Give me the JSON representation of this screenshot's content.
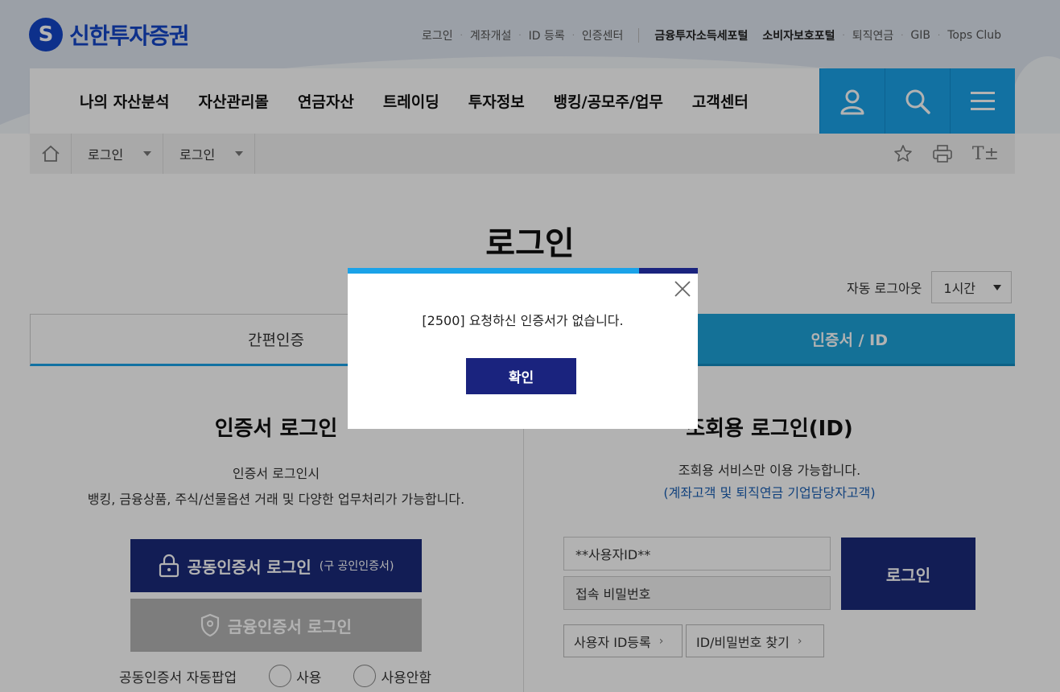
{
  "brand": {
    "logo_text": "신한투자증권",
    "logo_mark": "S"
  },
  "util_nav": [
    {
      "label": "로그인"
    },
    {
      "label": "계좌개설"
    },
    {
      "label": "ID 등록"
    },
    {
      "label": "인증센터"
    }
  ],
  "util_nav_bold": [
    {
      "label": "금융투자소득세포털"
    },
    {
      "label": "소비자보호포털"
    }
  ],
  "util_nav_extra": [
    {
      "label": "퇴직연금"
    },
    {
      "label": "GIB"
    },
    {
      "label": "Tops Club"
    }
  ],
  "gnb": {
    "menus": [
      "나의 자산분석",
      "자산관리몰",
      "연금자산",
      "트레이딩",
      "투자정보",
      "뱅킹/공모주/업무",
      "고객센터"
    ],
    "icons": [
      "user-icon",
      "search-icon",
      "hamburger-menu-icon"
    ]
  },
  "breadcrumb": {
    "items": [
      "로그인",
      "로그인"
    ],
    "tools": [
      "star-icon",
      "print-icon",
      "font-size-icon"
    ],
    "font_tool_label": "T±"
  },
  "page": {
    "title": "로그인",
    "auto_logout_label": "자동 로그아웃",
    "auto_logout_value": "1시간"
  },
  "tabs": {
    "left": "간편인증",
    "right": "인증서 / ID"
  },
  "cert_section": {
    "title": "인증서 로그인",
    "desc_line1": "인증서 로그인시",
    "desc_line2": "뱅킹, 금융상품, 주식/선물옵션 거래 및 다양한 업무처리가 가능합니다.",
    "cert_button": "공동인증서 로그인",
    "cert_button_sub": "(구 공인인증서)",
    "fin_button": "금융인증서 로그인",
    "popup_label": "공동인증서 자동팝업",
    "radio_use": "사용",
    "radio_nouse": "사용안함"
  },
  "id_section": {
    "title": "조회용 로그인(ID)",
    "desc_line1": "조회용 서비스만 이용 가능합니다.",
    "desc_line2": "(계좌고객 및 퇴직연금 기업담당자고객)",
    "user_id_value": "**사용자ID**",
    "password_placeholder": "접속 비밀번호",
    "login_button": "로그인",
    "register_button": "사용자 ID등록",
    "find_button": "ID/비밀번호 찾기"
  },
  "modal": {
    "message": "[2500] 요청하신 인증서가 없습니다.",
    "ok_button": "확인"
  },
  "colors": {
    "brand_blue": "#1446c8",
    "accent_cyan": "#1aa2e8",
    "navy": "#1a237e"
  }
}
